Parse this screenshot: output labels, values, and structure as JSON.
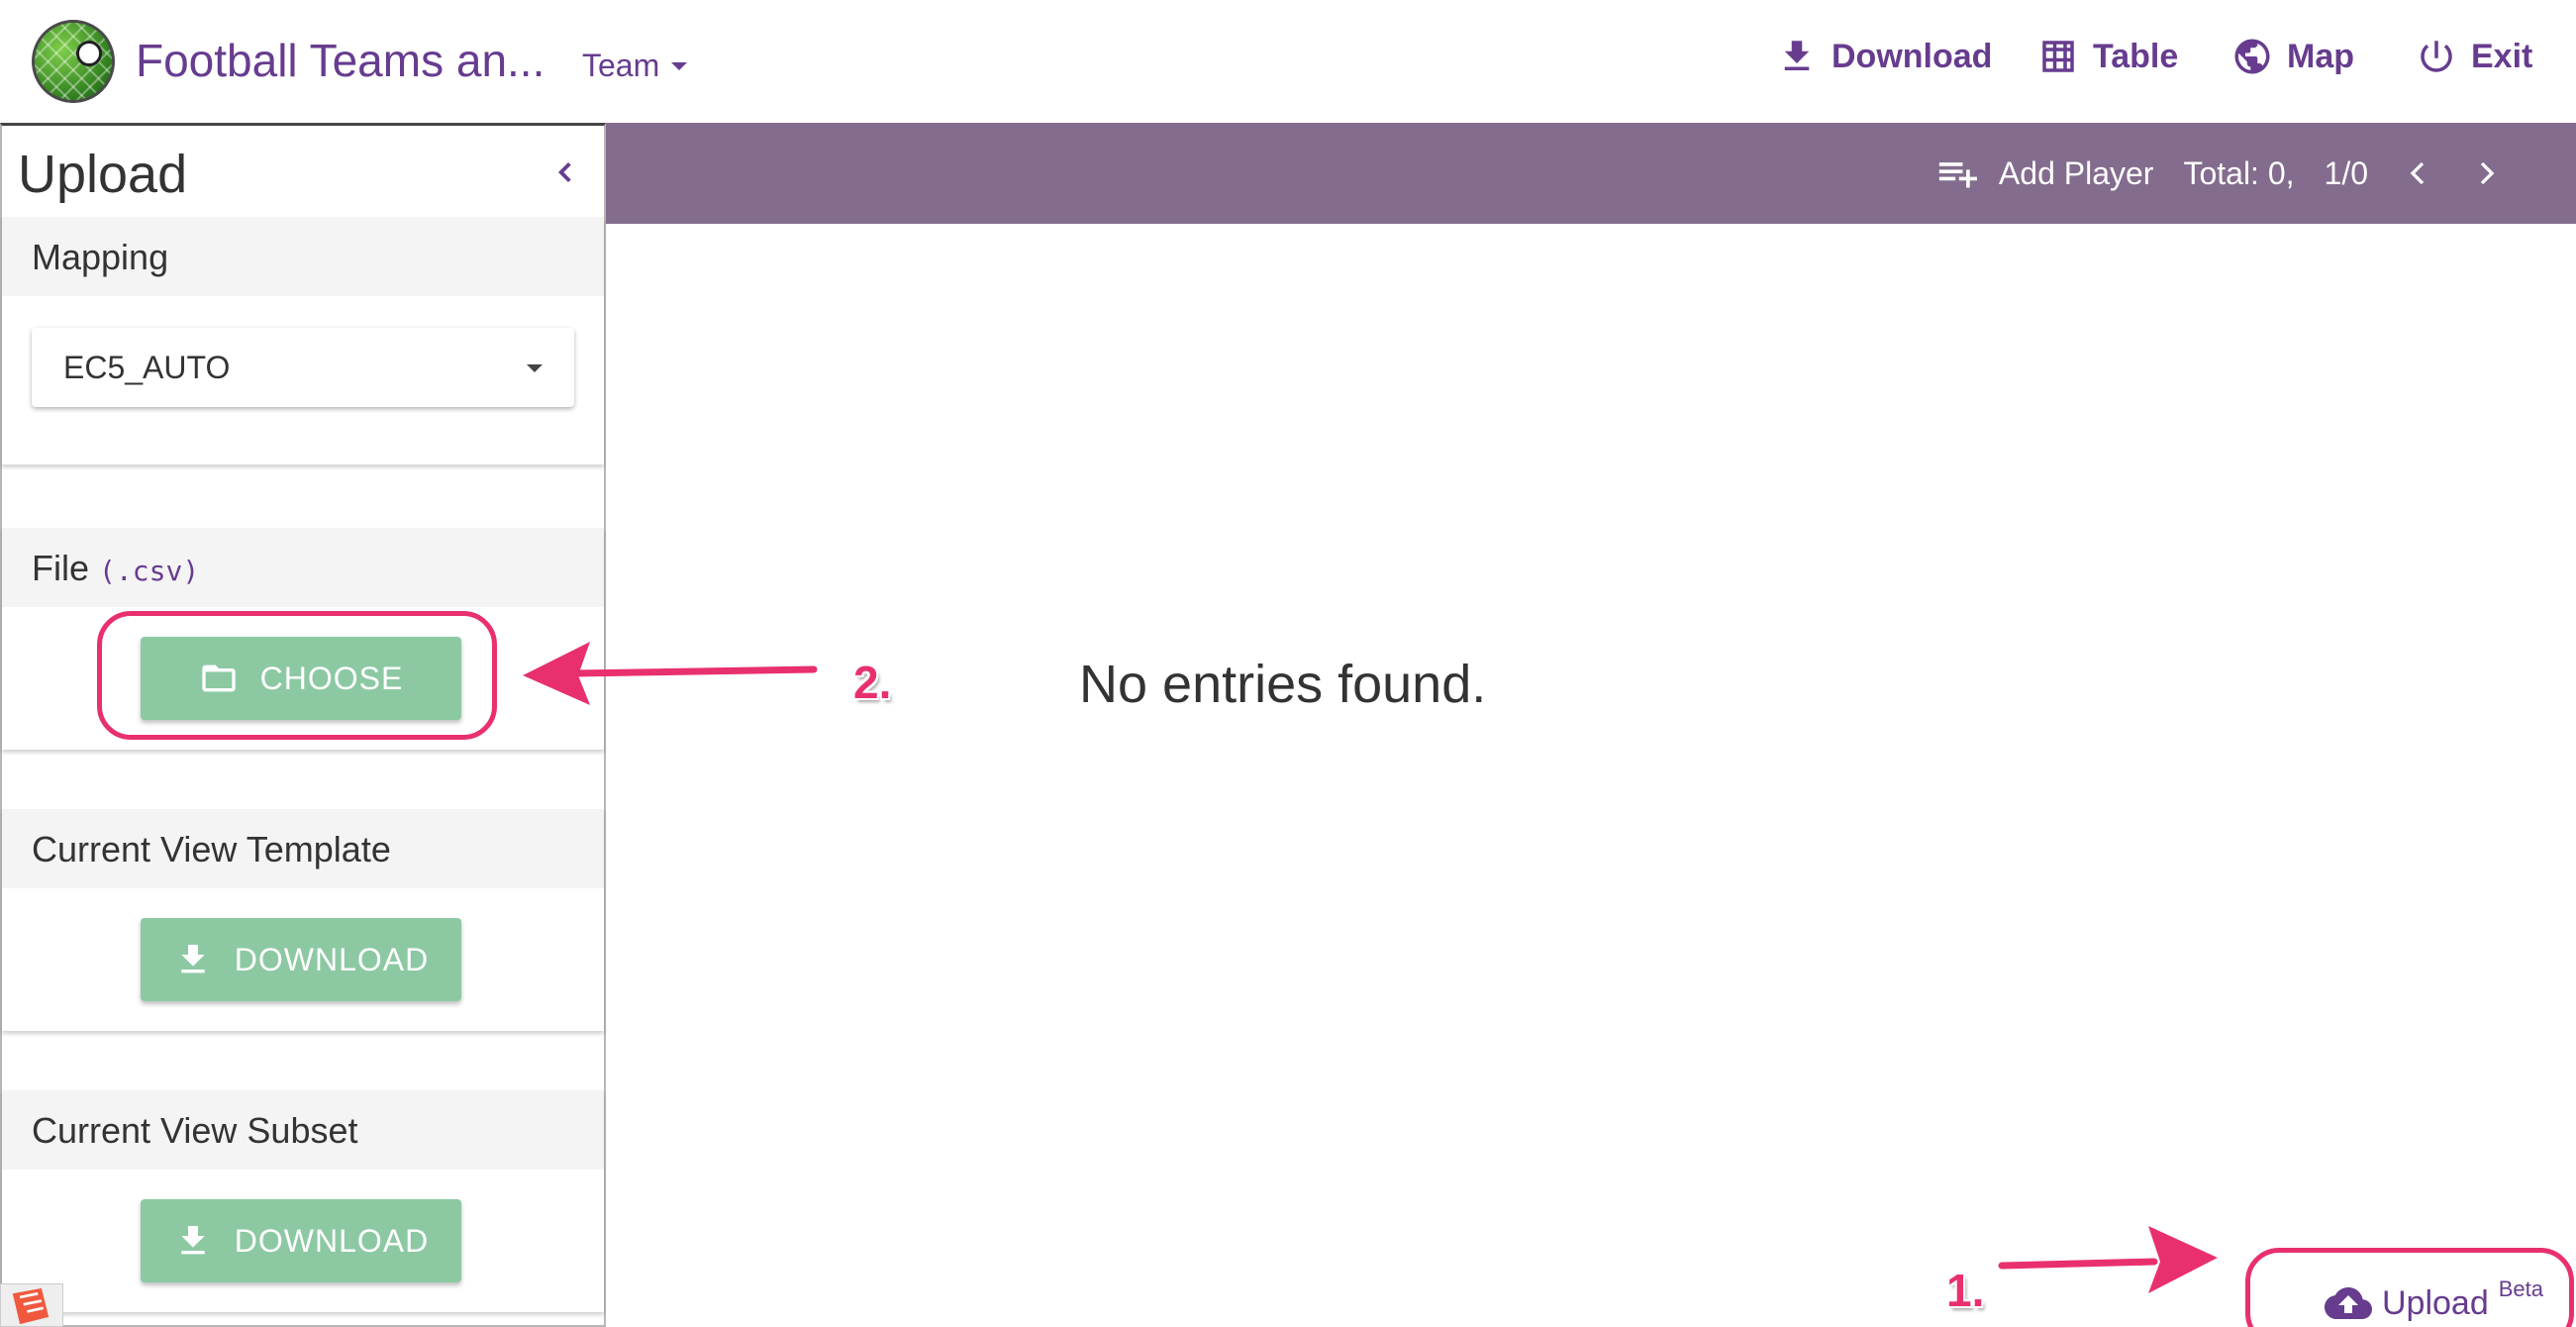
{
  "header": {
    "app_title": "Football Teams an...",
    "form_selector": "Team",
    "nav": {
      "download": "Download",
      "table": "Table",
      "map": "Map",
      "exit": "Exit"
    }
  },
  "upload_panel": {
    "title": "Upload",
    "mapping": {
      "heading": "Mapping",
      "selected": "EC5_AUTO"
    },
    "file": {
      "heading": "File",
      "extension": "(.csv)",
      "button": "CHOOSE"
    },
    "template": {
      "heading": "Current View Template",
      "button": "DOWNLOAD"
    },
    "subset": {
      "heading": "Current View Subset",
      "button": "DOWNLOAD"
    }
  },
  "toolbar": {
    "add_label": "Add Player",
    "total": "Total: 0,",
    "page": "1/0"
  },
  "main": {
    "empty_message": "No entries found."
  },
  "upload_fab": {
    "label": "Upload",
    "badge": "Beta"
  },
  "annotations": {
    "step1": "1.",
    "step2": "2."
  },
  "colors": {
    "brand_purple": "#673c8f",
    "toolbar_bg": "#836c8d",
    "button_green": "#8cc9a3",
    "annotation_pink": "#e8306f"
  }
}
